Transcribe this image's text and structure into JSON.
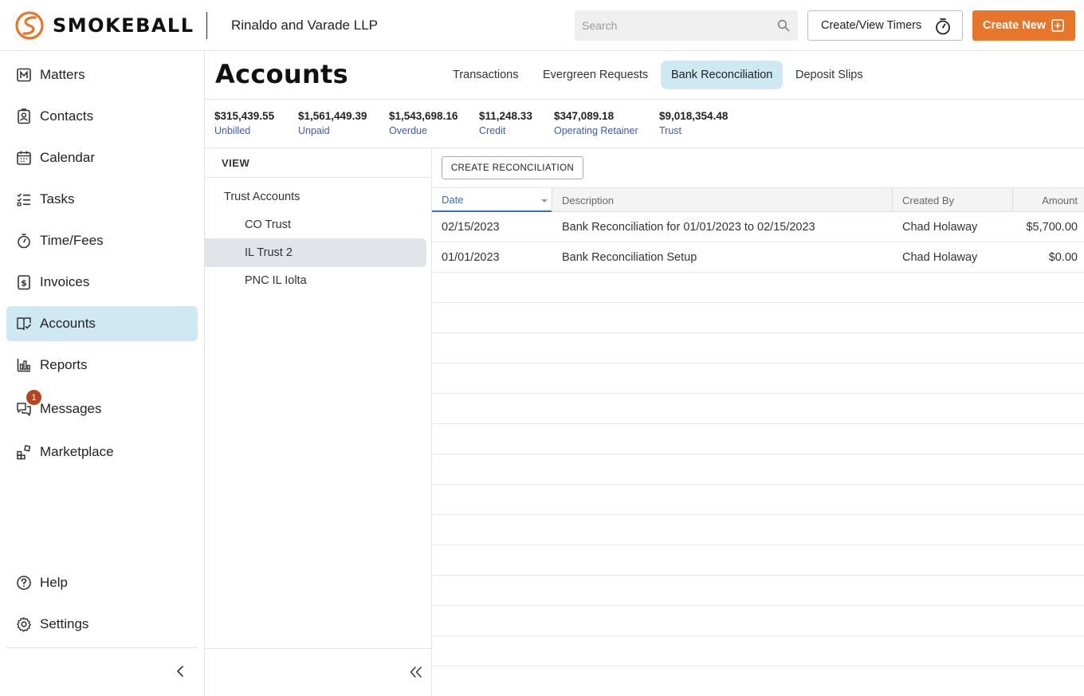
{
  "brand": {
    "name": "SMOKEBALL",
    "accent": "#e8762a"
  },
  "firm_name": "Rinaldo and Varade LLP",
  "search": {
    "placeholder": "Search"
  },
  "header_buttons": {
    "timers_label": "Create/View Timers",
    "create_new_label": "Create New"
  },
  "sidebar": {
    "items": [
      {
        "label": "Matters",
        "icon": "matters-icon",
        "active": false
      },
      {
        "label": "Contacts",
        "icon": "contacts-icon",
        "active": false
      },
      {
        "label": "Calendar",
        "icon": "calendar-icon",
        "active": false
      },
      {
        "label": "Tasks",
        "icon": "tasks-icon",
        "active": false
      },
      {
        "label": "Time/Fees",
        "icon": "stopwatch-icon",
        "active": false
      },
      {
        "label": "Invoices",
        "icon": "invoice-icon",
        "active": false
      },
      {
        "label": "Accounts",
        "icon": "accounts-icon",
        "active": true
      },
      {
        "label": "Reports",
        "icon": "reports-icon",
        "active": false
      },
      {
        "label": "Messages",
        "icon": "messages-icon",
        "active": false,
        "badge": "1"
      },
      {
        "label": "Marketplace",
        "icon": "marketplace-icon",
        "active": false
      }
    ],
    "bottom_items": [
      {
        "label": "Help",
        "icon": "help-icon"
      },
      {
        "label": "Settings",
        "icon": "gear-icon"
      }
    ]
  },
  "page": {
    "title": "Accounts",
    "tabs": [
      {
        "label": "Transactions",
        "active": false
      },
      {
        "label": "Evergreen Requests",
        "active": false
      },
      {
        "label": "Bank Reconciliation",
        "active": true
      },
      {
        "label": "Deposit Slips",
        "active": false
      }
    ],
    "stats": [
      {
        "value": "$315,439.55",
        "label": "Unbilled"
      },
      {
        "value": "$1,561,449.39",
        "label": "Unpaid"
      },
      {
        "value": "$1,543,698.16",
        "label": "Overdue"
      },
      {
        "value": "$11,248.33",
        "label": "Credit"
      },
      {
        "value": "$347,089.18",
        "label": "Operating Retainer"
      },
      {
        "value": "$9,018,354.48",
        "label": "Trust"
      }
    ]
  },
  "view_panel": {
    "heading": "VIEW",
    "root": "Trust Accounts",
    "accounts": [
      {
        "label": "CO Trust",
        "selected": false
      },
      {
        "label": "IL Trust 2",
        "selected": true
      },
      {
        "label": "PNC IL Iolta",
        "selected": false
      }
    ]
  },
  "reconciliation": {
    "create_button": "CREATE RECONCILIATION",
    "columns": {
      "date": "Date",
      "description": "Description",
      "created_by": "Created By",
      "amount": "Amount"
    },
    "rows": [
      {
        "date": "02/15/2023",
        "description": "Bank Reconciliation for 01/01/2023 to 02/15/2023",
        "created_by": "Chad Holaway",
        "amount": "$5,700.00"
      },
      {
        "date": "01/01/2023",
        "description": "Bank Reconciliation Setup",
        "created_by": "Chad Holaway",
        "amount": "$0.00"
      }
    ]
  }
}
